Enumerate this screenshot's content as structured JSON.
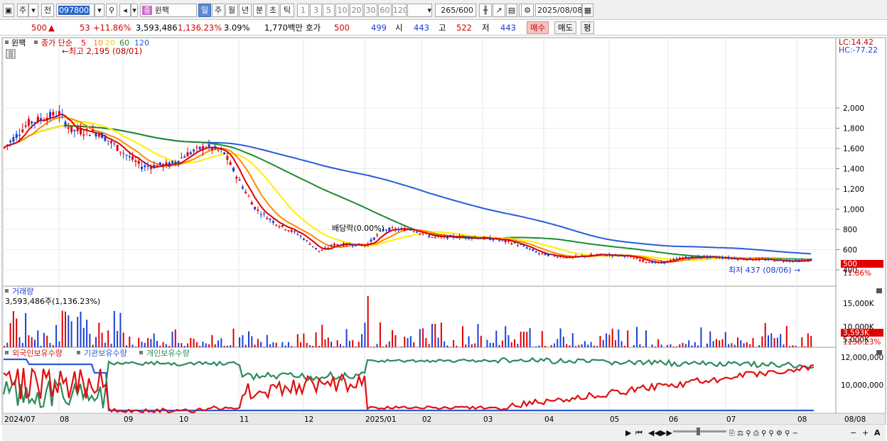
{
  "toolbar": {
    "market_btn": "주",
    "prev_btn": "전",
    "stock_code": "097800",
    "stock_name": "윈팩",
    "period_tabs": [
      "일",
      "주",
      "월",
      "년",
      "분",
      "초",
      "틱"
    ],
    "active_period": "일",
    "numbers": [
      "1",
      "3",
      "5",
      "10",
      "20",
      "30",
      "60",
      "120"
    ],
    "count": "265",
    "total": "/600",
    "date": "2025/08/08"
  },
  "quote": {
    "price": "500",
    "arrow": "▲",
    "change": "53",
    "change_pct": "+11.86%",
    "volume": "3,593,486",
    "vol_ratio": "1,136.23%",
    "turnover": "3.09%",
    "amount": "1,770백만",
    "bid_label": "호가",
    "ask_price": "500",
    "bid_price": "499",
    "open_label": "시",
    "open": "443",
    "high_label": "고",
    "high": "522",
    "low_label": "저",
    "low": "443",
    "buy_btn": "매수",
    "sell_btn": "매도",
    "eval_btn": "평"
  },
  "price_pane": {
    "name": "윈팩",
    "legend_prefix": "종가 단순",
    "ma_periods": [
      "5",
      "10",
      "20",
      "60",
      "120"
    ],
    "max_label": "최고 2,195 (08/01)",
    "min_label": "최저 437 (08/06)",
    "dividend_label": "배당락(0.00%)",
    "lc": "LC:14.42",
    "hc": "HC:-77.22",
    "last_price_tag": "500",
    "last_pct_tag": "11.86%",
    "y_ticks": [
      "2,000",
      "1,800",
      "1,600",
      "1,400",
      "1,200",
      "1,000",
      "800",
      "600",
      "400"
    ]
  },
  "volume_pane": {
    "title": "거래량",
    "value_label": "3,593,486주(1,136.23%)",
    "y_ticks": [
      "15,000K",
      "10,000K",
      "5,000K"
    ],
    "last_tag": "3,593K",
    "last_pct_tag": "1136.23%"
  },
  "holdings_pane": {
    "titles": [
      "외국인보유수량",
      "기관보유수량",
      "개인보유수량"
    ],
    "y_ticks": [
      "12,000,000",
      "10,000,000"
    ]
  },
  "x_axis": {
    "labels": [
      "2024/07",
      "08",
      "09",
      "10",
      "11",
      "12",
      "2025/01",
      "02",
      "03",
      "04",
      "05",
      "06",
      "07",
      "08"
    ],
    "right_label": "08/08"
  },
  "colors": {
    "ma5": "#e00000",
    "ma10": "#ff8a00",
    "ma20": "#ffee00",
    "ma60": "#1c8c2e",
    "ma120": "#2a5bdc",
    "up": "#e00000",
    "down": "#1a3fd6",
    "accent": "#5c8ad1"
  },
  "chart_data": {
    "type": "line",
    "series": [
      {
        "name": "외국인보유수량",
        "color": "#e01010"
      },
      {
        "name": "기관보유수량",
        "color": "#2a5bdc"
      },
      {
        "name": "개인보유수량",
        "color": "#2e8a5c"
      }
    ]
  }
}
